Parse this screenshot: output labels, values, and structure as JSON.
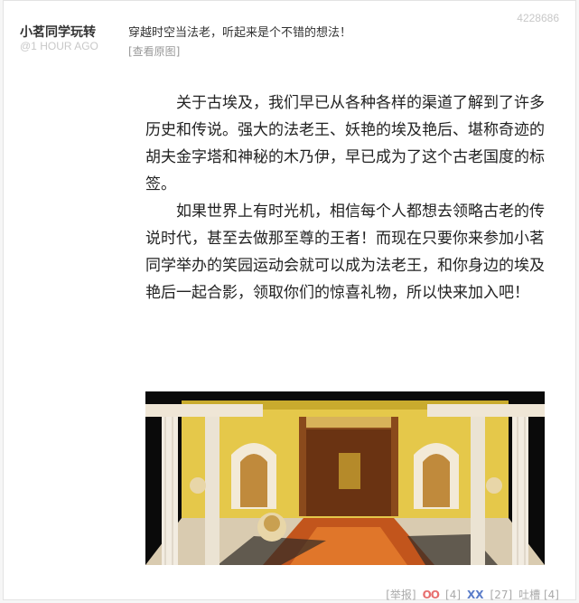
{
  "post": {
    "author": "小茗同学玩转",
    "time_ago": "@1 HOUR AGO",
    "post_id": "4228686",
    "title": "穿越时空当法老，听起来是个不错的想法！",
    "view_original_label": "[查看原图]",
    "paragraphs": [
      "关于古埃及，我们早已从各种各样的渠道了解到了许多历史和传说。强大的法老王、妖艳的埃及艳后、堪称奇迹的胡夫金字塔和神秘的木乃伊，早已成为了这个古老国度的标签。",
      "如果世界上有时光机，相信每个人都想去领略古老的传说时代，甚至去做那至尊的王者！而现在只要你来参加小茗同学举办的笑园运动会就可以成为法老王，和你身边的埃及艳后一起合影，领取你们的惊喜礼物，所以快来加入吧！"
    ]
  },
  "footer": {
    "report_label": "[举报]",
    "oo_label": "OO",
    "oo_count": "[4]",
    "xx_label": "XX",
    "xx_count": "[27]",
    "comment_label": "吐槽 [4]"
  },
  "colors": {
    "oo": "#e76f6f",
    "xx": "#5b7dc9",
    "muted": "#aaaaaa"
  }
}
